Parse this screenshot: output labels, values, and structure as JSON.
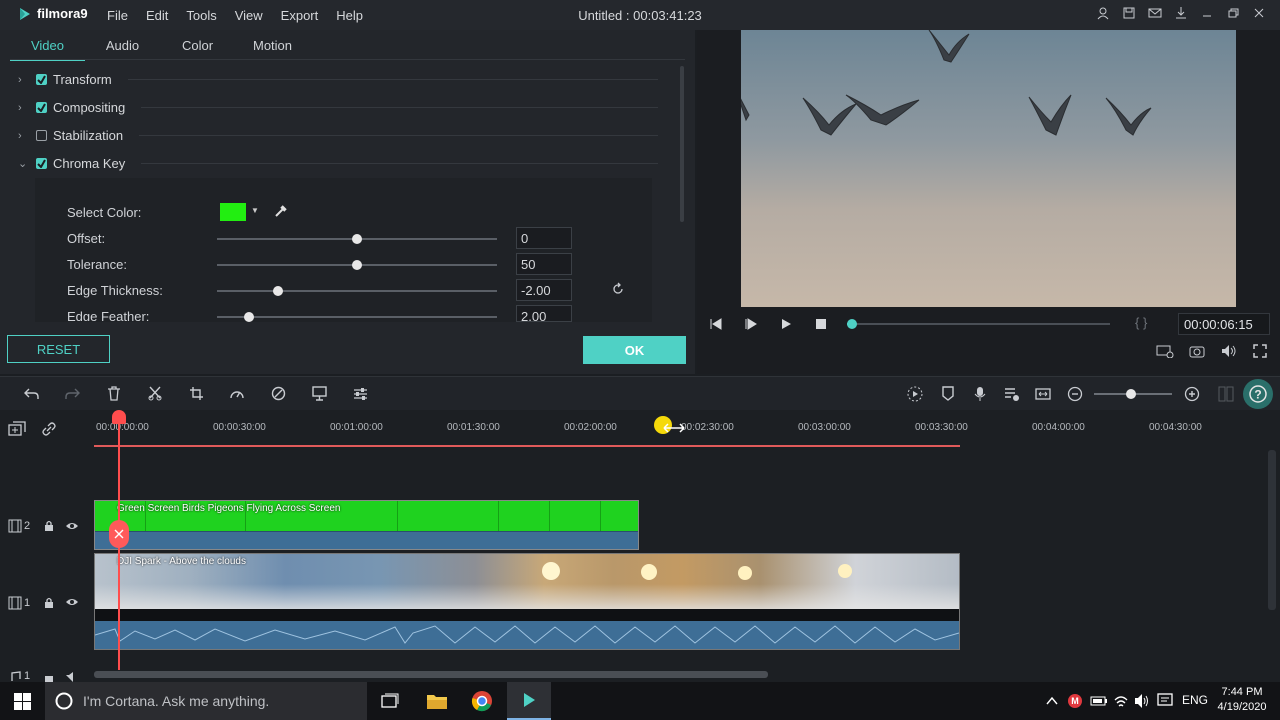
{
  "app": {
    "name": "filmora9",
    "title": "Untitled : 00:03:41:23",
    "menu": [
      "File",
      "Edit",
      "Tools",
      "View",
      "Export",
      "Help"
    ]
  },
  "panel": {
    "tabs": [
      "Video",
      "Audio",
      "Color",
      "Motion"
    ],
    "active_tab": "Video",
    "sections": [
      {
        "label": "Transform",
        "checked": true,
        "expanded": false
      },
      {
        "label": "Compositing",
        "checked": true,
        "expanded": false
      },
      {
        "label": "Stabilization",
        "checked": false,
        "expanded": false
      },
      {
        "label": "Chroma Key",
        "checked": true,
        "expanded": true
      }
    ],
    "chroma": {
      "select_color_label": "Select Color:",
      "color": "#22ee11",
      "offset_label": "Offset:",
      "offset_value": "0",
      "tolerance_label": "Tolerance:",
      "tolerance_value": "50",
      "edge_thickness_label": "Edge Thickness:",
      "edge_thickness_value": "-2.00",
      "edge_feather_label": "Edge Feather:",
      "edge_feather_value": "2.00"
    },
    "reset_label": "RESET",
    "ok_label": "OK"
  },
  "preview": {
    "timecode": "00:00:06:15",
    "brackets": "{ }"
  },
  "timeline": {
    "ruler": [
      "00:00:00:00",
      "00:00:30:00",
      "00:01:00:00",
      "00:01:30:00",
      "00:02:00:00",
      "00:02:30:00",
      "00:03:00:00",
      "00:03:30:00",
      "00:04:00:00",
      "00:04:30:00"
    ],
    "tracks": [
      {
        "number": "2",
        "clip": "Green Screen Birds Pigeons Flying Across Screen"
      },
      {
        "number": "1",
        "clip": "DJI Spark - Above the clouds"
      }
    ],
    "audio_track": "1"
  },
  "taskbar": {
    "search_placeholder": "I'm Cortana. Ask me anything.",
    "language": "ENG",
    "time": "7:44 PM",
    "date": "4/19/2020"
  },
  "colors": {
    "accent": "#4fd1c5",
    "green_clip": "#1fd21f",
    "playhead": "#ff4d4d"
  }
}
